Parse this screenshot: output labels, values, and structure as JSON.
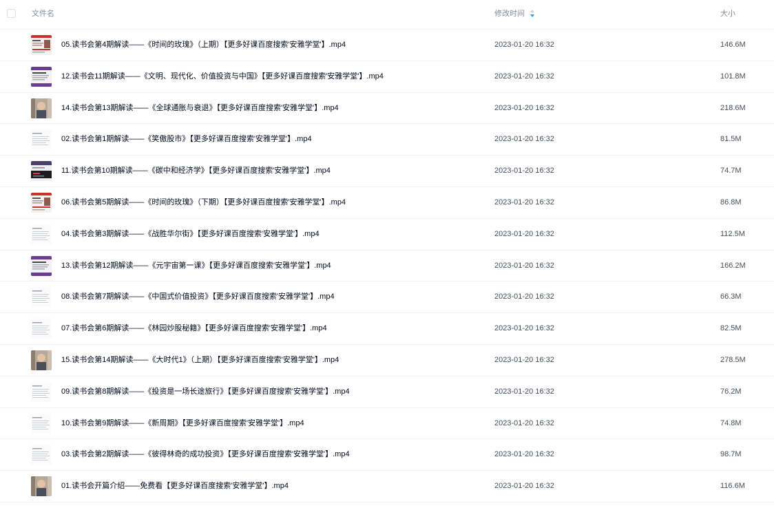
{
  "header": {
    "name_label": "文件名",
    "time_label": "修改时间",
    "size_label": "大小",
    "sort_icon": "sort-arrow-icon"
  },
  "files": [
    {
      "name": "05.读书会第4期解读——《时间的玫瑰》（上期）【更多好课百度搜索'安雅学堂'】.mp4",
      "time": "2023-01-20 16:32",
      "size": "146.6M",
      "thumb": "thumb-red"
    },
    {
      "name": "12.读书会11期解读——《文明、现代化、价值投资与中国》【更多好课百度搜索'安雅学堂'】.mp4",
      "time": "2023-01-20 16:32",
      "size": "101.8M",
      "thumb": "thumb-purple"
    },
    {
      "name": "14.读书会第13期解读——《全球通胀与衰退》【更多好课百度搜索'安雅学堂'】.mp4",
      "time": "2023-01-20 16:32",
      "size": "218.6M",
      "thumb": "thumb-photo"
    },
    {
      "name": "02.读书会第1期解读——《笑傲股市》【更多好课百度搜索'安雅学堂'】.mp4",
      "time": "2023-01-20 16:32",
      "size": "81.5M",
      "thumb": "thumb-doc"
    },
    {
      "name": "11.读书会第10期解读——《碳中和经济学》【更多好课百度搜索'安雅学堂'】.mp4",
      "time": "2023-01-20 16:32",
      "size": "74.7M",
      "thumb": "thumb-dark"
    },
    {
      "name": "06.读书会第5期解读——《时间的玫瑰》（下期）【更多好课百度搜索'安雅学堂'】.mp4",
      "time": "2023-01-20 16:32",
      "size": "86.8M",
      "thumb": "thumb-red"
    },
    {
      "name": "04.读书会第3期解读——《战胜华尔街》【更多好课百度搜索'安雅学堂'】.mp4",
      "time": "2023-01-20 16:32",
      "size": "112.5M",
      "thumb": "thumb-doc"
    },
    {
      "name": "13.读书会第12期解读——《元宇宙第一课》【更多好课百度搜索'安雅学堂'】.mp4",
      "time": "2023-01-20 16:32",
      "size": "166.2M",
      "thumb": "thumb-purple"
    },
    {
      "name": "08.读书会第7期解读——《中国式价值投资》【更多好课百度搜索'安雅学堂'】.mp4",
      "time": "2023-01-20 16:32",
      "size": "66.3M",
      "thumb": "thumb-doc"
    },
    {
      "name": "07.读书会第6期解读——《林园炒股秘籍》【更多好课百度搜索'安雅学堂'】.mp4",
      "time": "2023-01-20 16:32",
      "size": "82.5M",
      "thumb": "thumb-doc"
    },
    {
      "name": "15.读书会第14期解读——《大时代1》（上期）【更多好课百度搜索'安雅学堂'】.mp4",
      "time": "2023-01-20 16:32",
      "size": "278.5M",
      "thumb": "thumb-photo"
    },
    {
      "name": "09.读书会第8期解读——《投资是一场长途旅行》【更多好课百度搜索'安雅学堂'】.mp4",
      "time": "2023-01-20 16:32",
      "size": "76.2M",
      "thumb": "thumb-doc"
    },
    {
      "name": "10.读书会第9期解读——《新周期》【更多好课百度搜索'安雅学堂'】.mp4",
      "time": "2023-01-20 16:32",
      "size": "74.8M",
      "thumb": "thumb-doc"
    },
    {
      "name": "03.读书会第2期解读——《彼得林奇的成功投资》【更多好课百度搜索'安雅学堂'】.mp4",
      "time": "2023-01-20 16:32",
      "size": "98.7M",
      "thumb": "thumb-doc"
    },
    {
      "name": "01.读书会开篇介绍——免费看【更多好课百度搜索'安雅学堂'】.mp4",
      "time": "2023-01-20 16:32",
      "size": "116.6M",
      "thumb": "thumb-photo"
    }
  ],
  "colors": {
    "accent": "#06a7ff",
    "text": "#03081a",
    "muted": "#878c9c",
    "divider": "#f1f2f5"
  }
}
